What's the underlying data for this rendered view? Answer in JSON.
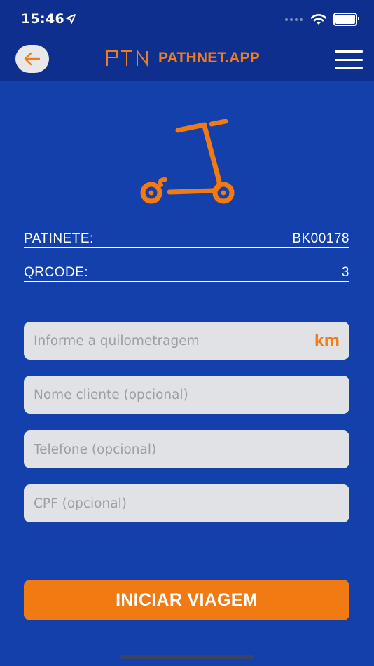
{
  "status_bar": {
    "time": "15:46"
  },
  "header": {
    "brand_name": "PATHNET.APP",
    "logo_letters": "PTN"
  },
  "details": {
    "scooter_label": "PATINETE:",
    "scooter_value": "BK00178",
    "qrcode_label": "QRCODE:",
    "qrcode_value": "3"
  },
  "form": {
    "mileage_placeholder": "Informe a quilometragem",
    "mileage_unit": "km",
    "name_placeholder": "Nome cliente (opcional)",
    "phone_placeholder": "Telefone (opcional)",
    "cpf_placeholder": "CPF (opcional)"
  },
  "actions": {
    "start_label": "INICIAR VIAGEM"
  },
  "colors": {
    "background": "#1440ab",
    "header": "#0e2f8e",
    "accent": "#f27a12",
    "input_bg": "#e1e2e6"
  },
  "icons": {
    "back": "arrow-left-icon",
    "menu": "hamburger-icon",
    "scooter": "scooter-icon",
    "wifi": "wifi-icon",
    "battery": "battery-icon",
    "location": "location-arrow-icon"
  }
}
